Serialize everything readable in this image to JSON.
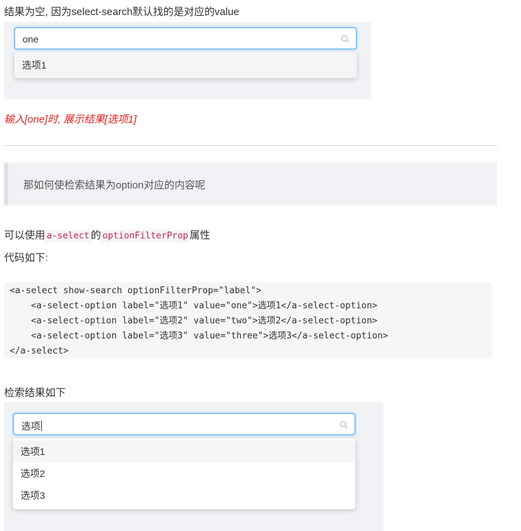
{
  "section1": {
    "heading": "结果为空, 因为select-search默认找的是对应的value",
    "search_value": "one",
    "options": [
      "选项1"
    ],
    "note": "输入[one]时, 展示结果[选项1]"
  },
  "quote": {
    "text": "那如何使检索结果为option对应的内容呢"
  },
  "explain": {
    "prefix": "可以使用",
    "code_component": "a-select",
    "middle": "的",
    "code_prop": "optionFilterProp",
    "suffix": "属性",
    "code_label": "代码如下:"
  },
  "code_lines": [
    "<a-select show-search optionFilterProp=\"label\">",
    "    <a-select-option label=\"选项1\" value=\"one\">选项1</a-select-option>",
    "    <a-select-option label=\"选项2\" value=\"two\">选项2</a-select-option>",
    "    <a-select-option label=\"选项3\" value=\"three\">选项3</a-select-option>",
    "</a-select>"
  ],
  "section2": {
    "heading": "检索结果如下",
    "search_value": "选项",
    "options": [
      "选项1",
      "选项2",
      "选项3"
    ]
  },
  "colors": {
    "accent": "#40a9ff",
    "note": "#e02020",
    "inline_code": "#c7254e"
  },
  "icons": {
    "search": "search-icon"
  }
}
